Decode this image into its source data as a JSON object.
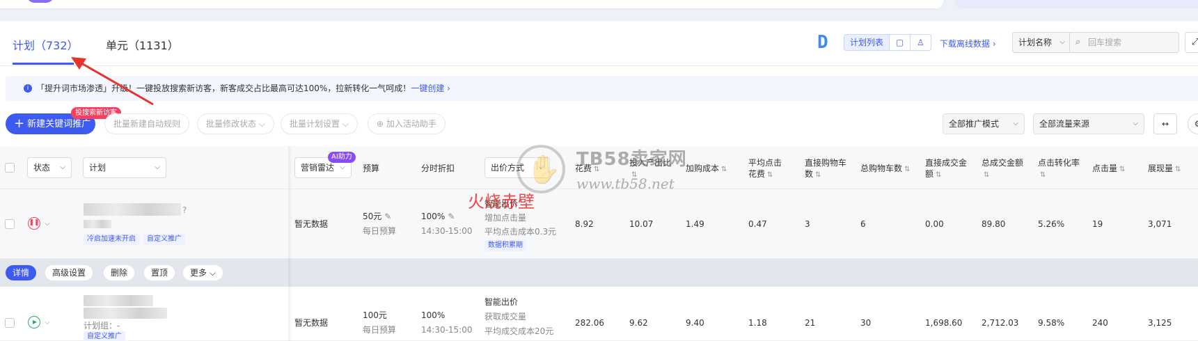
{
  "tabs": [
    {
      "label": "计划（732）",
      "active": true
    },
    {
      "label": "单元（1131）",
      "active": false
    }
  ],
  "toolbar_right": {
    "view_plan_list": "计划列表",
    "download_offline": "下载离线数据",
    "search_field_select": "计划名称",
    "search_placeholder": "回车搜索"
  },
  "notice": {
    "text": "「提升词市场渗透」升级！一键投放搜索新访客，新客成交占比最高可达100%，拉新转化一气呵成！",
    "link": "一键创建"
  },
  "actions": {
    "new_keyword_promo": "新建关键词推广",
    "new_badge": "投搜索新访客",
    "batch_auto_rule": "批量新建自动规则",
    "batch_status": "批量修改状态",
    "batch_plan_settings": "批量计划设置",
    "add_activity_helper": "加入活动助手",
    "mode_filter": "全部推广模式",
    "traffic_filter": "全部流量来源"
  },
  "columns": {
    "status": "状态",
    "plan": "计划",
    "marketing_radar": "营销雷达",
    "ai_badge": "AI助力",
    "budget": "预算",
    "time_discount": "分时折扣",
    "bid_method": "出价方式",
    "cost": "花费",
    "roi": "投入产出比",
    "cart_cost": "加购成本",
    "avg_click_cost": "平均点击花费",
    "direct_cart": "直接购物车数",
    "total_cart": "总购物车数",
    "direct_gmv": "直接成交金额",
    "total_gmv": "总成交金额",
    "ctr_conv": "点击转化率",
    "clicks": "点击量",
    "impressions": "展现量"
  },
  "rows": [
    {
      "status": "paused",
      "plan_name_suffix": "?",
      "tags": [
        "冷启加速未开启",
        "自定义推广"
      ],
      "radar": "暂无数据",
      "budget": "50元",
      "budget_type": "每日预算",
      "discount": "100%",
      "discount_time": "14:30-15:00",
      "bid_title": "智能出价",
      "bid_goal": "增加点击量",
      "bid_detail": "平均点击成本0.3元",
      "bid_tag": "数据积累期",
      "cost": "8.92",
      "roi": "10.07",
      "cart_cost": "1.49",
      "avg_click_cost": "0.47",
      "direct_cart": "3",
      "total_cart": "6",
      "direct_gmv": "0.00",
      "total_gmv": "89.80",
      "ctr_conv": "5.26%",
      "clicks": "19",
      "impressions": "3,071"
    },
    {
      "status": "running",
      "plan_group": "计划组：-",
      "tags": [
        "自定义推广"
      ],
      "radar": "暂无数据",
      "budget": "100元",
      "budget_type": "每日预算",
      "discount": "100%",
      "discount_time": "14:30-15:00",
      "bid_title": "智能出价",
      "bid_goal": "获取成交量",
      "bid_detail": "平均成交成本20元",
      "cost": "282.06",
      "roi": "9.62",
      "cart_cost": "9.40",
      "avg_click_cost": "1.18",
      "direct_cart": "21",
      "total_cart": "30",
      "direct_gmv": "1,698.60",
      "total_gmv": "2,712.03",
      "ctr_conv": "9.58%",
      "clicks": "240",
      "impressions": "3,125"
    }
  ],
  "row_actions": [
    "详情",
    "高级设置",
    "删除",
    "置顶",
    "更多"
  ],
  "watermark": {
    "title": "TB58卖家网",
    "url": "www.tb58.net",
    "overlay": "火烧赤壁"
  },
  "colors": {
    "primary": "#3d5af1",
    "danger": "#f5405f",
    "success": "#20b26a",
    "ai": "#8a4cf0"
  }
}
